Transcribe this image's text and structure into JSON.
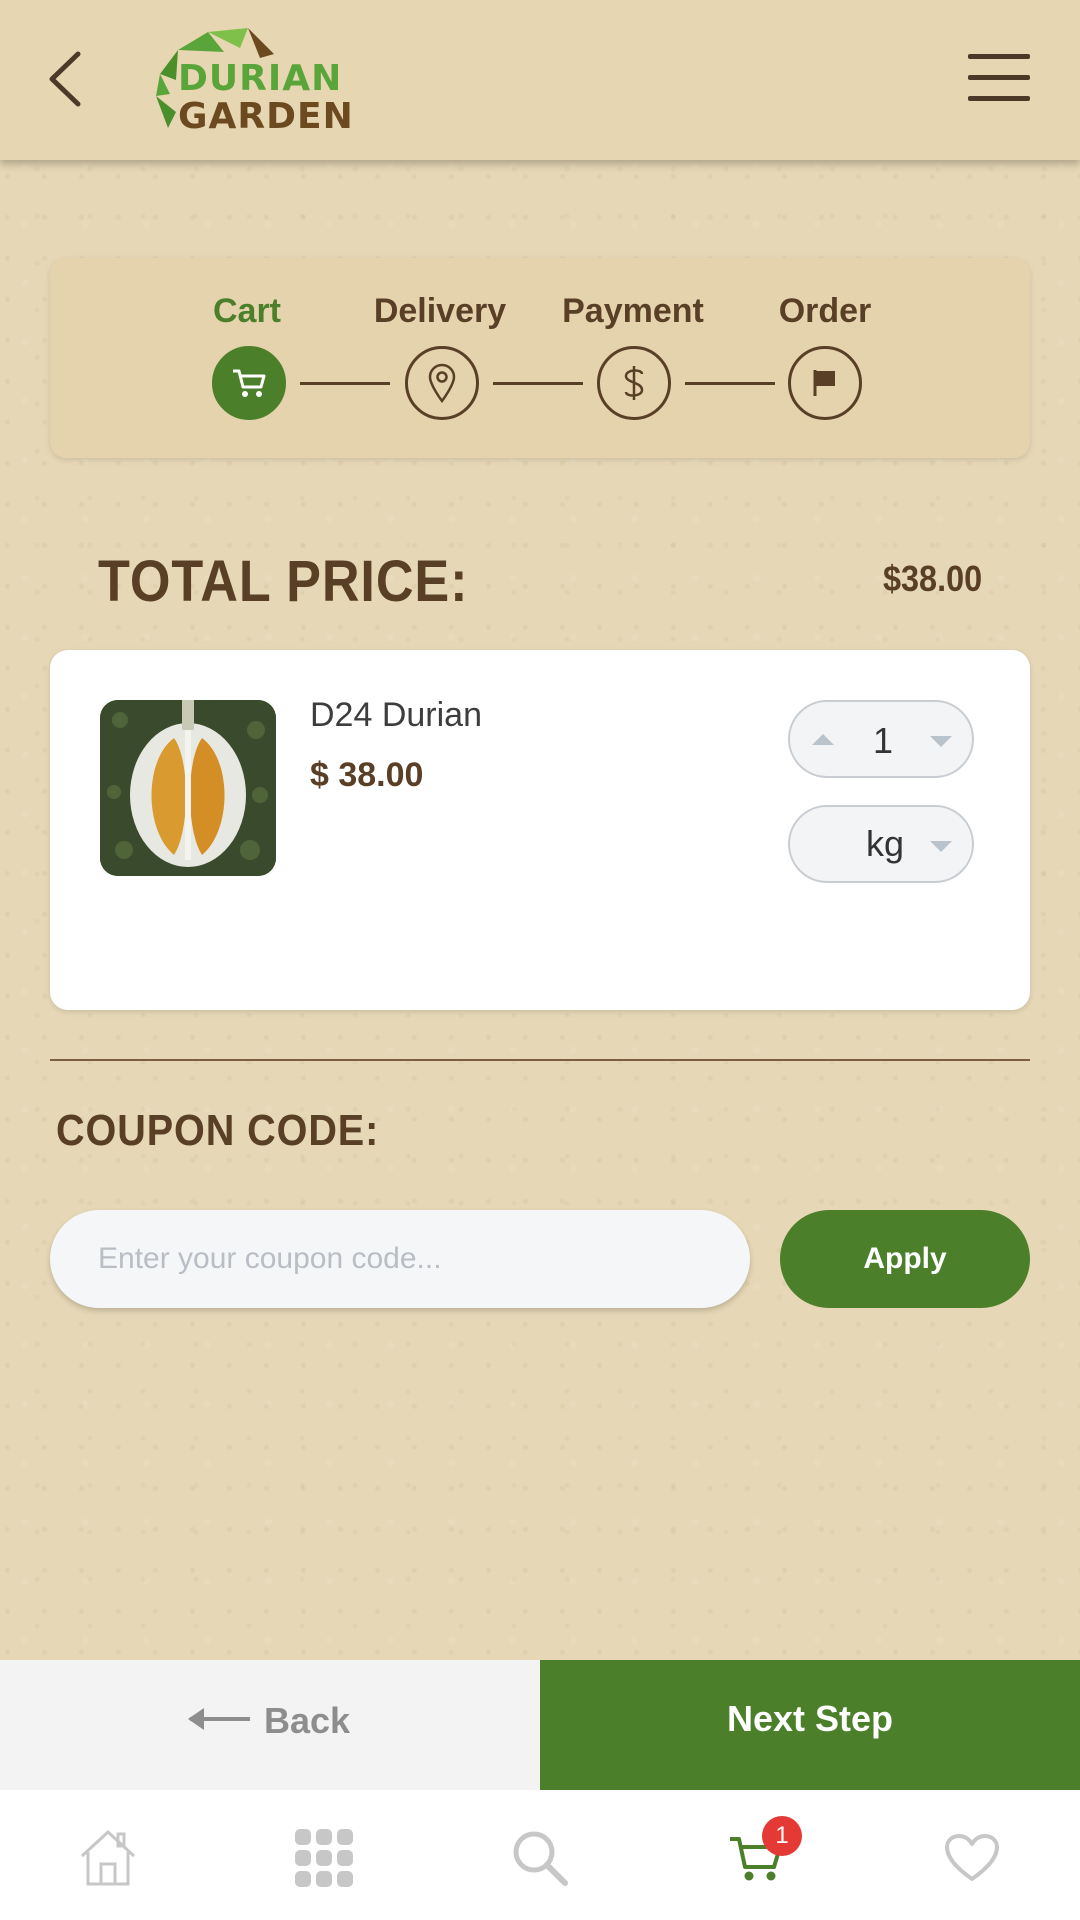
{
  "header": {
    "logo_line1": "DURIAN",
    "logo_line2": "GARDEN",
    "back_icon": "chevron-left-icon",
    "menu_icon": "hamburger-menu-icon"
  },
  "steps": [
    {
      "label": "Cart",
      "icon": "cart-icon",
      "active": true
    },
    {
      "label": "Delivery",
      "icon": "location-pin-icon",
      "active": false
    },
    {
      "label": "Payment",
      "icon": "dollar-icon",
      "active": false
    },
    {
      "label": "Order",
      "icon": "flag-icon",
      "active": false
    }
  ],
  "total": {
    "label": "TOTAL PRICE:",
    "value": "$38.00"
  },
  "cart_items": [
    {
      "name": "D24 Durian",
      "price": "$ 38.00",
      "quantity": "1",
      "unit": "kg"
    }
  ],
  "coupon": {
    "label": "COUPON CODE:",
    "placeholder": "Enter your coupon code...",
    "value": "",
    "apply_label": "Apply"
  },
  "actions": {
    "back_label": "Back",
    "next_label": "Next Step"
  },
  "tabbar": {
    "items": [
      {
        "icon": "home-icon",
        "active": false
      },
      {
        "icon": "grid-icon",
        "active": false
      },
      {
        "icon": "search-icon",
        "active": false
      },
      {
        "icon": "cart-icon",
        "active": true
      },
      {
        "icon": "heart-icon",
        "active": false
      }
    ],
    "cart_badge": "1"
  },
  "colors": {
    "brand_green": "#4b7f2a",
    "brand_brown": "#5a3f27",
    "background": "#e6d8b6",
    "badge_red": "#e53935"
  }
}
